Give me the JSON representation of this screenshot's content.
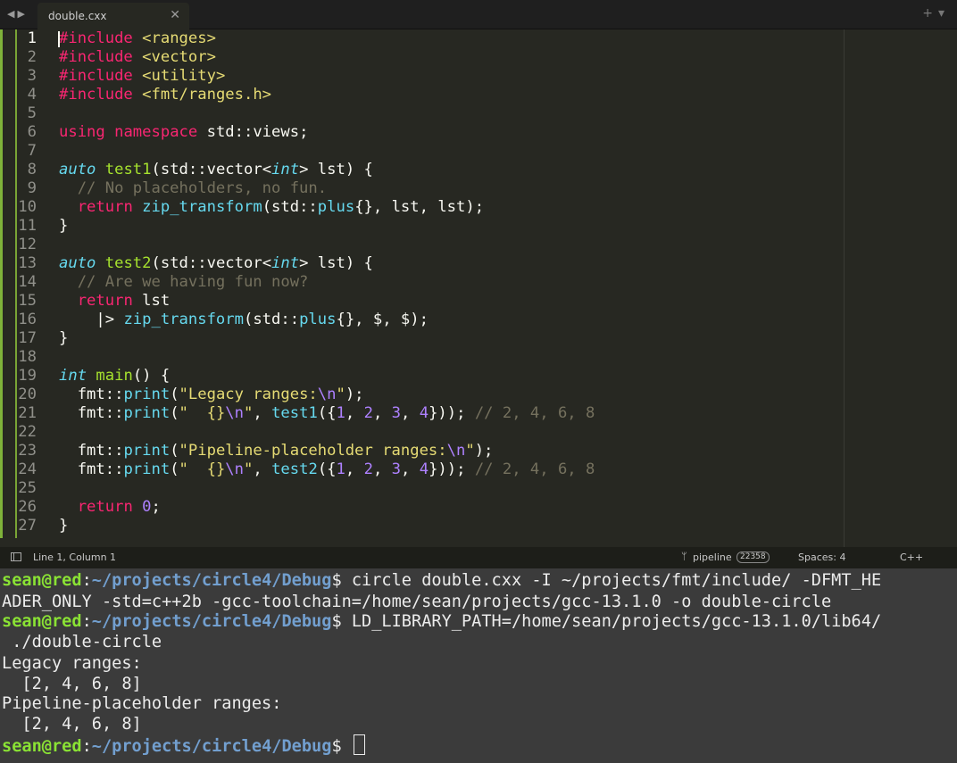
{
  "tab": {
    "filename": "double.cxx"
  },
  "editor": {
    "lines": [
      "1",
      "2",
      "3",
      "4",
      "5",
      "6",
      "7",
      "8",
      "9",
      "10",
      "11",
      "12",
      "13",
      "14",
      "15",
      "16",
      "17",
      "18",
      "19",
      "20",
      "21",
      "22",
      "23",
      "24",
      "25",
      "26",
      "27"
    ]
  },
  "status": {
    "position": "Line 1, Column 1",
    "branch": "pipeline",
    "branch_count": "22358",
    "spaces": "Spaces: 4",
    "language": "C++"
  },
  "terminal": {
    "user": "sean@red",
    "path": "~/projects/circle4/Debug",
    "prompt_char": "$",
    "cmd1_part1": " circle double.cxx -I ~/projects/fmt/include/ -DFMT_HE",
    "cmd1_part2": "ADER_ONLY -std=c++2b -gcc-toolchain=/home/sean/projects/gcc-13.1.0 -o double-circle",
    "cmd2_part1": " LD_LIBRARY_PATH=/home/sean/projects/gcc-13.1.0/lib64/",
    "cmd2_part2": " ./double-circle",
    "out1": "Legacy ranges:",
    "out2": "  [2, 4, 6, 8]",
    "out3": "Pipeline-placeholder ranges:",
    "out4": "  [2, 4, 6, 8]"
  },
  "colors": {
    "editor_bg": "#272822",
    "keyword": "#f92672",
    "string": "#e6db74",
    "type": "#66d9ef",
    "function": "#a6e22e",
    "comment": "#75715e",
    "number": "#ae81ff",
    "terminal_bg": "#3b3b3b",
    "prompt_user": "#8ae234",
    "prompt_path": "#729fcf"
  }
}
